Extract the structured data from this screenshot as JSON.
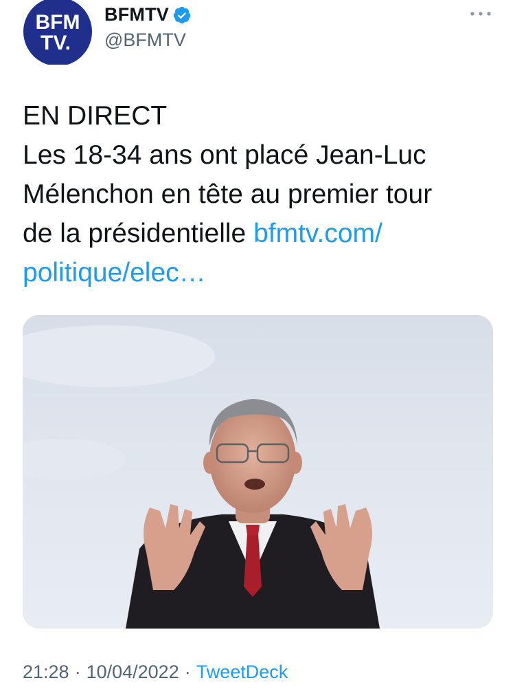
{
  "header": {
    "avatar_logo_text": "BFM TV.",
    "display_name": "BFMTV",
    "handle": "@BFMTV",
    "verified_icon": "verified-badge-icon",
    "more_icon": "more-horizontal-icon"
  },
  "tweet": {
    "line1": "EN DIRECT",
    "line2": "Les 18-34 ans ont placé Jean-Luc",
    "line3": "Mélenchon en tête au premier tour",
    "line4_text": "de la présidentielle ",
    "line4_link": "bfmtv.com/",
    "line5_link": "politique/elec…"
  },
  "media": {
    "image_icon": "photo-politician-speaking"
  },
  "meta": {
    "time": "21:28",
    "date": "10/04/2022",
    "source": "TweetDeck",
    "separator": "·"
  },
  "colors": {
    "brand_blue": "#1d9bf0",
    "bfm_navy": "#1f2f8b",
    "text_primary": "#0f1419",
    "text_secondary": "#536471"
  }
}
